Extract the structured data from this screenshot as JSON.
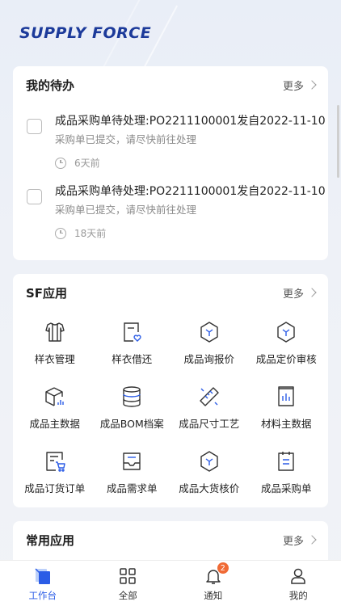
{
  "brand": "SUPPLY FORCE",
  "todo": {
    "title": "我的待办",
    "more": "更多",
    "items": [
      {
        "title": "成品采购单待处理:PO2211100001发自2022-11-10",
        "desc": "采购单已提交，请尽快前往处理",
        "time": "6天前"
      },
      {
        "title": "成品采购单待处理:PO2211100001发自2022-11-10",
        "desc": "采购单已提交，请尽快前往处理",
        "time": "18天前"
      }
    ]
  },
  "sf_apps": {
    "title": "SF应用",
    "more": "更多",
    "items": [
      {
        "label": "样衣管理",
        "icon": "garment-icon"
      },
      {
        "label": "样衣借还",
        "icon": "document-heart-icon"
      },
      {
        "label": "成品询报价",
        "icon": "cube-icon"
      },
      {
        "label": "成品定价审核",
        "icon": "cube-icon"
      },
      {
        "label": "成品主数据",
        "icon": "box-chart-icon"
      },
      {
        "label": "成品BOM档案",
        "icon": "database-icon"
      },
      {
        "label": "成品尺寸工艺",
        "icon": "ruler-icon"
      },
      {
        "label": "材料主数据",
        "icon": "chart-document-icon"
      },
      {
        "label": "成品订货订单",
        "icon": "cart-document-icon"
      },
      {
        "label": "成品需求单",
        "icon": "inbox-icon"
      },
      {
        "label": "成品大货核价",
        "icon": "cube-icon"
      },
      {
        "label": "成品采购单",
        "icon": "clipboard-icon"
      }
    ]
  },
  "common_apps": {
    "title": "常用应用",
    "more": "更多"
  },
  "tabbar": {
    "items": [
      {
        "label": "工作台",
        "icon": "workbench-icon",
        "active": true
      },
      {
        "label": "全部",
        "icon": "grid-icon",
        "active": false
      },
      {
        "label": "通知",
        "icon": "bell-icon",
        "active": false,
        "badge": "2"
      },
      {
        "label": "我的",
        "icon": "user-icon",
        "active": false
      }
    ]
  },
  "colors": {
    "accent": "#2b5ce6",
    "brand": "#1c3a9a",
    "badge": "#f06a35"
  }
}
